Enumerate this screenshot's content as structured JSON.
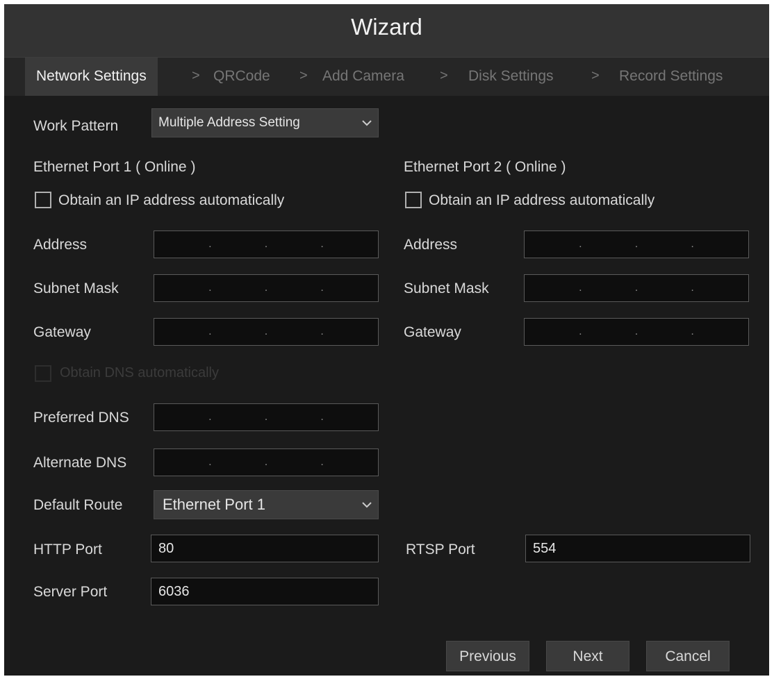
{
  "window": {
    "title": "Wizard"
  },
  "steps": [
    {
      "label": "Network Settings"
    },
    {
      "label": "QRCode"
    },
    {
      "label": "Add Camera"
    },
    {
      "label": "Disk Settings"
    },
    {
      "label": "Record Settings"
    }
  ],
  "step_separator": ">",
  "work_pattern": {
    "label": "Work Pattern",
    "value": "Multiple Address Setting"
  },
  "port1": {
    "title": "Ethernet Port 1 ( Online )",
    "obtain_auto_label": "Obtain an IP address automatically",
    "obtain_auto_checked": false,
    "address_label": "Address",
    "subnet_label": "Subnet Mask",
    "gateway_label": "Gateway",
    "ip_dot": "."
  },
  "port2": {
    "title": "Ethernet Port 2 ( Online )",
    "obtain_auto_label": "Obtain an IP address automatically",
    "obtain_auto_checked": false,
    "address_label": "Address",
    "subnet_label": "Subnet Mask",
    "gateway_label": "Gateway",
    "ip_dot": "."
  },
  "dns": {
    "obtain_auto_label": "Obtain DNS automatically",
    "preferred_label": "Preferred DNS",
    "alternate_label": "Alternate DNS"
  },
  "default_route": {
    "label": "Default Route",
    "value": "Ethernet Port 1"
  },
  "http_port": {
    "label": "HTTP Port",
    "value": "80"
  },
  "rtsp_port": {
    "label": "RTSP Port",
    "value": "554"
  },
  "server_port": {
    "label": "Server Port",
    "value": "6036"
  },
  "buttons": {
    "previous": "Previous",
    "next": "Next",
    "cancel": "Cancel"
  },
  "colors": {
    "background": "#1b1b1b",
    "titlebar": "#333333",
    "field": "#0e0e0e",
    "text": "#d9d9d9",
    "inactive_step": "#767676"
  }
}
